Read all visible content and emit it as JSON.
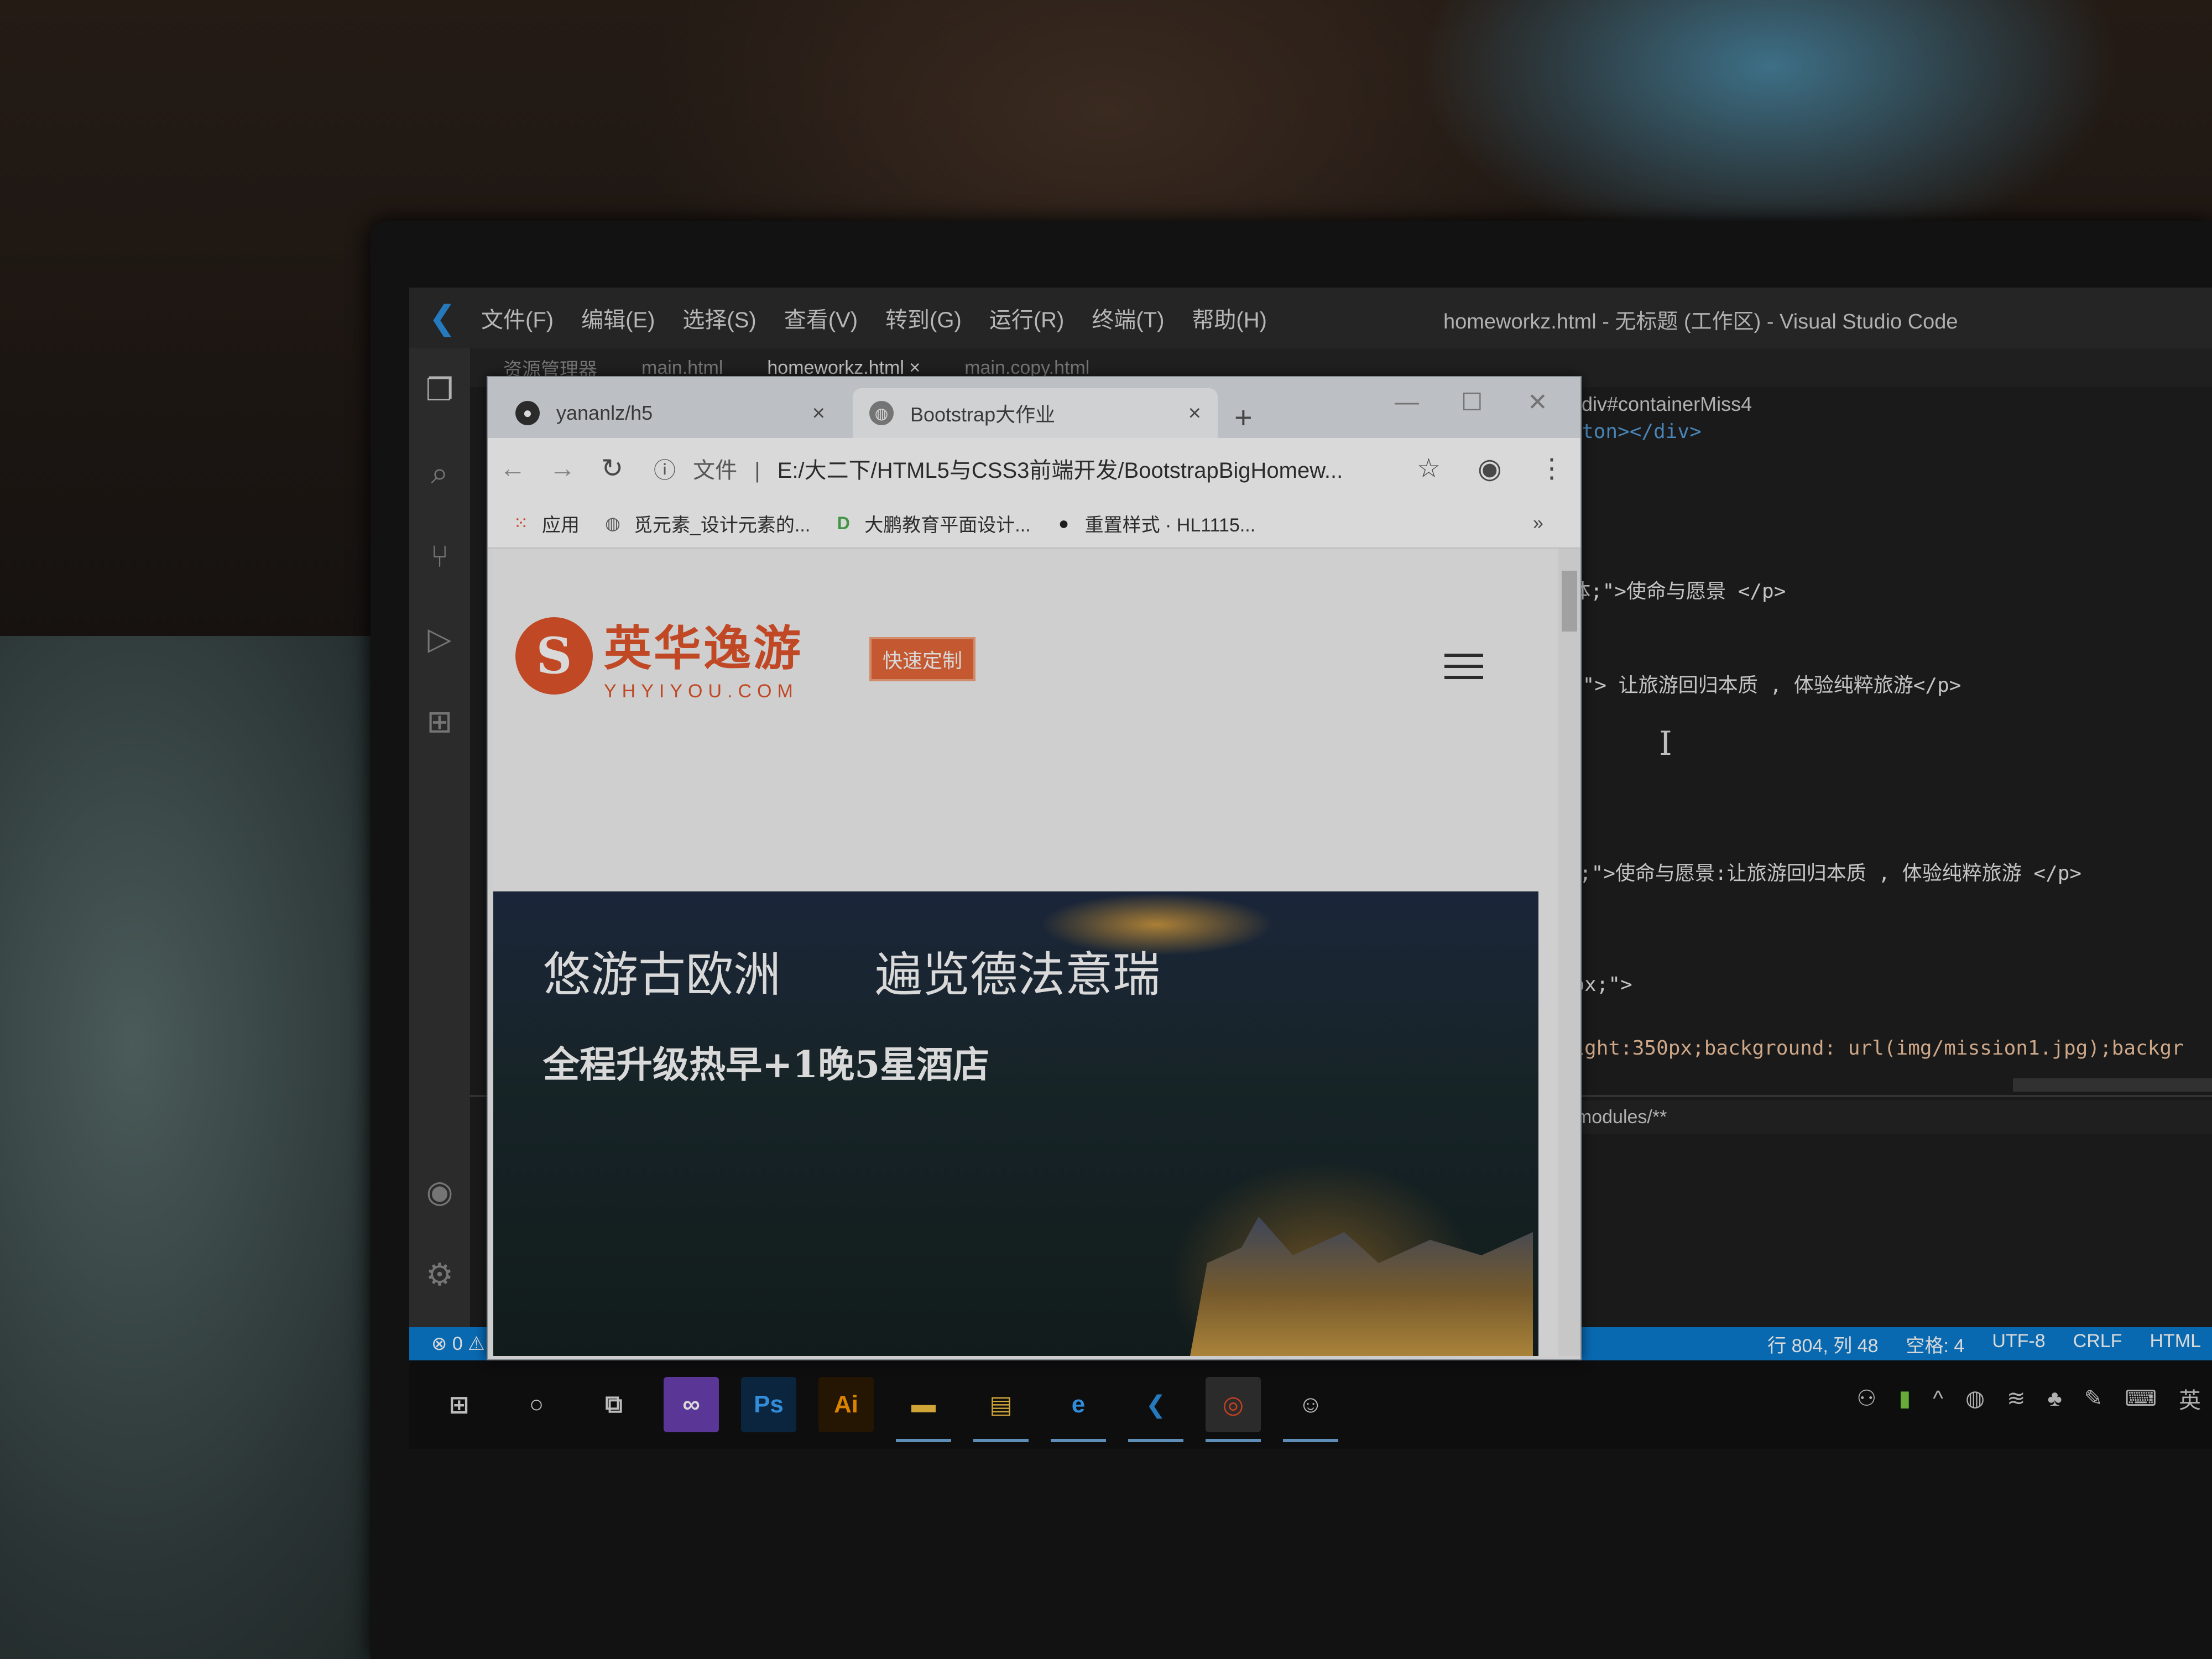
{
  "vscode": {
    "window_title": "homeworkz.html - 无标题 (工作区) - Visual Studio Code",
    "menu": [
      "文件(F)",
      "编辑(E)",
      "选择(S)",
      "查看(V)",
      "转到(G)",
      "运行(R)",
      "终端(T)",
      "帮助(H)"
    ],
    "editor_tabs": [
      "资源管理器",
      "main.html",
      "homeworkz.html ×",
      "main.copy.html"
    ],
    "breadcrumb": "div#containerMiss4",
    "code_lines": [
      "ton></div>",
      "体;\">使命与愿景 </p>",
      ";\"> 让旅游回归本质 , 体验纯粹旅游</p>",
      "体;\">使命与愿景:让旅游回归本质 , 体验纯粹旅游 </p>",
      "50px;\">",
      "height:350px;background: url(img/mission1.jpg);backgr"
    ],
    "terminal_header": "!**/node_modules/**",
    "status_left": "⊗ 0 ⚠ 0",
    "status_right": [
      "行 804, 列 48",
      "空格: 4",
      "UTF-8",
      "CRLF",
      "HTML"
    ]
  },
  "browser": {
    "tabs": [
      {
        "title": "yananlz/h5"
      },
      {
        "title": "Bootstrap大作业"
      }
    ],
    "url_scheme": "文件",
    "url": "E:/大二下/HTML5与CSS3前端开发/BootstrapBigHomew...",
    "bookmarks": [
      "应用",
      "觅元素_设计元素的...",
      "大鹏教育平面设计...",
      "重置样式 · HL1115..."
    ],
    "bookmarks_more": "»"
  },
  "site": {
    "logo_cn": "英华逸游",
    "logo_en": "YHYIYOU.COM",
    "quick_button": "快速定制",
    "hero_title_1": "悠游古欧洲",
    "hero_title_2": "遍览德法意瑞",
    "hero_subtitle": "全程升级热早+1晚5星酒店"
  },
  "taskbar": {
    "input_indicator": "英"
  },
  "colors": {
    "vscode_status": "#0a7bd0",
    "brand_orange": "#e2552a"
  }
}
